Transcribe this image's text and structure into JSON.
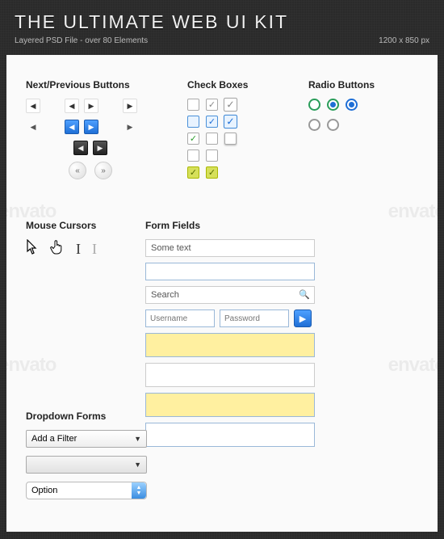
{
  "header": {
    "title": "THE ULTIMATE WEB UI KIT",
    "subtitle": "Layered PSD File - over 80 Elements",
    "dimensions": "1200 x 850 px"
  },
  "watermark": "envato",
  "sections": {
    "nav": "Next/Previous Buttons",
    "check": "Check Boxes",
    "radio": "Radio Buttons",
    "cursors": "Mouse Cursors",
    "form": "Form Fields",
    "dropdown": "Dropdown Forms"
  },
  "form": {
    "some_text": "Some text",
    "search": "Search",
    "username": "Username",
    "password": "Password"
  },
  "dropdown": {
    "filter": "Add a Filter",
    "option": "Option"
  },
  "glyphs": {
    "left": "◀",
    "right": "▶",
    "dleft": "«",
    "dright": "»",
    "check": "✓",
    "dot": "",
    "mag": "🔍",
    "arrow": "▶",
    "caret": "▼",
    "up": "▲",
    "pointer": "↖",
    "hand": "☝",
    "text": "I"
  }
}
